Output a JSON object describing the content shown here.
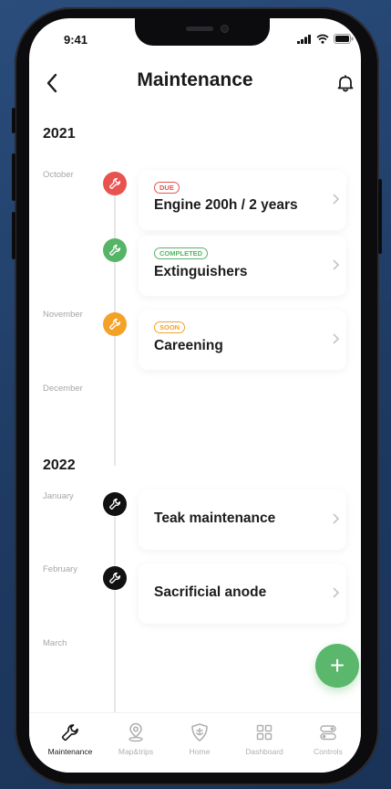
{
  "status_bar": {
    "time": "9:41"
  },
  "header": {
    "title": "Maintenance"
  },
  "years": [
    "2021",
    "2022"
  ],
  "months": [
    "October",
    "November",
    "December",
    "January",
    "February",
    "March"
  ],
  "items": [
    {
      "badge": "DUE",
      "title": "Engine 200h / 2 years",
      "color": "#e8524f"
    },
    {
      "badge": "COMPLETED",
      "title": "Extinguishers",
      "color": "#56b466"
    },
    {
      "badge": "SOON",
      "title": "Careening",
      "color": "#f4a227"
    },
    {
      "badge": "",
      "title": "Teak maintenance",
      "color": "#111111"
    },
    {
      "badge": "",
      "title": "Sacrificial anode",
      "color": "#111111"
    }
  ],
  "fab": {
    "label": "+",
    "color": "#5ab76b"
  },
  "tabs": [
    {
      "label": "Maintenance",
      "icon": "wrench-icon",
      "active": true
    },
    {
      "label": "Map&trips",
      "icon": "map-pin-icon",
      "active": false
    },
    {
      "label": "Home",
      "icon": "shield-icon",
      "active": false
    },
    {
      "label": "Dashboard",
      "icon": "grid-icon",
      "active": false
    },
    {
      "label": "Controls",
      "icon": "toggles-icon",
      "active": false
    }
  ]
}
